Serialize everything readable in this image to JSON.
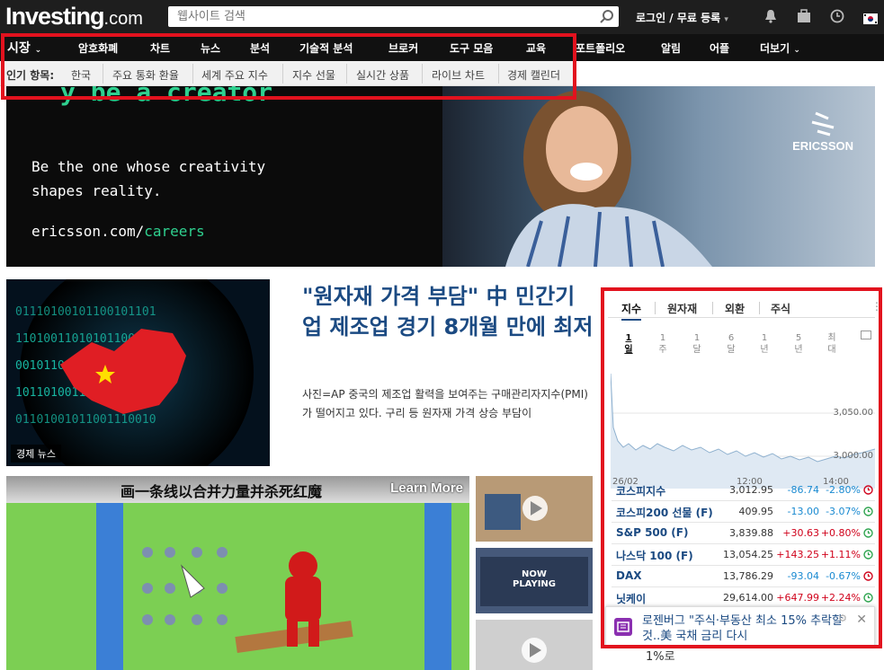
{
  "header": {
    "logo_main": "Investing",
    "logo_suffix": ".com",
    "search_placeholder": "웹사이트 검색",
    "login": "로그인 / 무료 등록",
    "login_caret": "▾"
  },
  "main_nav": {
    "items": [
      "시장",
      "암호화폐",
      "차트",
      "뉴스",
      "분석",
      "기술적 분석",
      "브로커",
      "도구 모음",
      "교육",
      "포트폴리오",
      "알림",
      "어플",
      "더보기"
    ]
  },
  "sub_nav": {
    "label": "인기 항목:",
    "tabs": [
      "한국",
      "주요 통화 환율",
      "세계 주요 지수",
      "지수 선물",
      "실시간 상품",
      "라이브 차트",
      "경제 캘린더"
    ]
  },
  "ad": {
    "partial_heading": "y be a creator",
    "tagline_1": "Be the one whose creativity",
    "tagline_2": "shapes reality.",
    "url_main": "ericsson.com/",
    "url_path": "careers",
    "brand": "ERICSSON"
  },
  "article": {
    "badge": "경제 뉴스",
    "title": "\"원자재 가격 부담\" 中 민간기업 제조업 경기 8개월 만에 최저",
    "body": "사진=AP 중국의 제조업 활력을 보여주는 구매관리자지수(PMI)가 떨어지고 있다. 구리 등 원자재 가격 상승 부담이"
  },
  "game_ad": {
    "title": "画一条线以合并力量并杀死红魔",
    "learn_more": "Learn More"
  },
  "thumb_now_playing": "NOW\nPLAYING",
  "widget": {
    "tabs": [
      "지수",
      "원자재",
      "외환",
      "주식"
    ],
    "more": "⋮",
    "periods": [
      {
        "num": "1",
        "unit": "일"
      },
      {
        "num": "1",
        "unit": "주"
      },
      {
        "num": "1",
        "unit": "달"
      },
      {
        "num": "6",
        "unit": "달"
      },
      {
        "num": "1",
        "unit": "년"
      },
      {
        "num": "5",
        "unit": "년"
      },
      {
        "num": "최",
        "unit": "대"
      }
    ],
    "chart_labels": {
      "y_high": "3,050.00",
      "y_low": "3,000.00",
      "x_start": "26/02",
      "x_mid": "12:00",
      "x_end": "14:00"
    },
    "rows": [
      {
        "name": "코스피지수",
        "value": "3,012.95",
        "change": "-86.74",
        "pct": "-2.80%",
        "dir": "neg",
        "clock": "red"
      },
      {
        "name": "코스피200 선물 (F)",
        "value": "409.95",
        "change": "-13.00",
        "pct": "-3.07%",
        "dir": "neg",
        "clock": "green"
      },
      {
        "name": "S&P 500 (F)",
        "value": "3,839.88",
        "change": "+30.63",
        "pct": "+0.80%",
        "dir": "pos",
        "clock": "green"
      },
      {
        "name": "나스닥 100 (F)",
        "value": "13,054.25",
        "change": "+143.25",
        "pct": "+1.11%",
        "dir": "pos",
        "clock": "green"
      },
      {
        "name": "DAX",
        "value": "13,786.29",
        "change": "-93.04",
        "pct": "-0.67%",
        "dir": "neg",
        "clock": "red"
      },
      {
        "name": "닛케이",
        "value": "29,614.00",
        "change": "+647.99",
        "pct": "+2.24%",
        "dir": "pos",
        "clock": "green"
      }
    ]
  },
  "popup": {
    "text": "로젠버그 \"주식·부동산 최소 15% 추락할 것..美 국채 금리 다시",
    "below": "1%로",
    "close": "✕",
    "gear": "⚙"
  },
  "colors": {
    "highlight_border": "#e2121e",
    "link_blue": "#1b4a82",
    "negative": "#1a8ad1",
    "positive": "#d0021b"
  }
}
